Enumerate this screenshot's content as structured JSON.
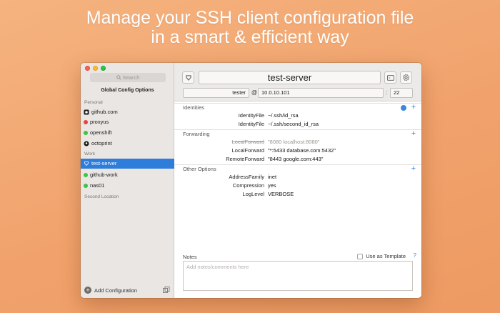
{
  "headline": {
    "line1": "Manage your SSH client configuration file",
    "line2": "in a smart & efficient way"
  },
  "sidebar": {
    "search_placeholder": "Search",
    "global_config_label": "Global Config Options",
    "sections": [
      {
        "title": "Personal",
        "items": [
          {
            "label": "github.com",
            "icon": "github-icon",
            "color": "#1b1b1b"
          },
          {
            "label": "proxyus",
            "icon": "status-dot",
            "color": "#e8433c"
          },
          {
            "label": "openshift",
            "icon": "status-dot",
            "color": "#3ec445"
          },
          {
            "label": "octoprint",
            "icon": "octoprint-icon",
            "color": "#1b1b1b"
          }
        ]
      },
      {
        "title": "Work",
        "items": [
          {
            "label": "test-server",
            "icon": "server-icon",
            "color": "#ffffff",
            "selected": true
          },
          {
            "label": "github-work",
            "icon": "status-dot",
            "color": "#3ec445"
          },
          {
            "label": "nas01",
            "icon": "status-dot",
            "color": "#3ec445"
          }
        ]
      },
      {
        "title": "Second Location",
        "items": []
      }
    ],
    "add_label": "Add Configuration"
  },
  "toolbar": {
    "host_name": "test-server",
    "user": "tester",
    "at_sign": "@",
    "hostname": "10.0.10.101",
    "colon": ":",
    "port": "22"
  },
  "groups": {
    "identities": {
      "title": "Identities",
      "rows": [
        {
          "key": "IdentityFile",
          "value": "~/.ssh/id_rsa"
        },
        {
          "key": "IdentityFile",
          "value": "~/.ssh/second_id_rsa"
        }
      ]
    },
    "forwarding": {
      "title": "Forwarding",
      "rows": [
        {
          "key": "LocalForward",
          "value": "\"8080 localhost:8080\"",
          "disabled": true
        },
        {
          "key": "LocalForward",
          "value": "\"*:5433 database.com:5432\""
        },
        {
          "key": "RemoteForward",
          "value": "\"8443 google.com:443\""
        }
      ]
    },
    "other": {
      "title": "Other Options",
      "rows": [
        {
          "key": "AddressFamily",
          "value": "inet"
        },
        {
          "key": "Compression",
          "value": "yes"
        },
        {
          "key": "LogLevel",
          "value": "VERBOSE"
        }
      ]
    }
  },
  "notes": {
    "label": "Notes",
    "template_label": "Use as Template",
    "help": "?",
    "placeholder": "Add notes/comments here"
  },
  "colors": {
    "accent": "#3b86e0",
    "selection": "#2f7ddb",
    "background": "#f1a26c"
  }
}
